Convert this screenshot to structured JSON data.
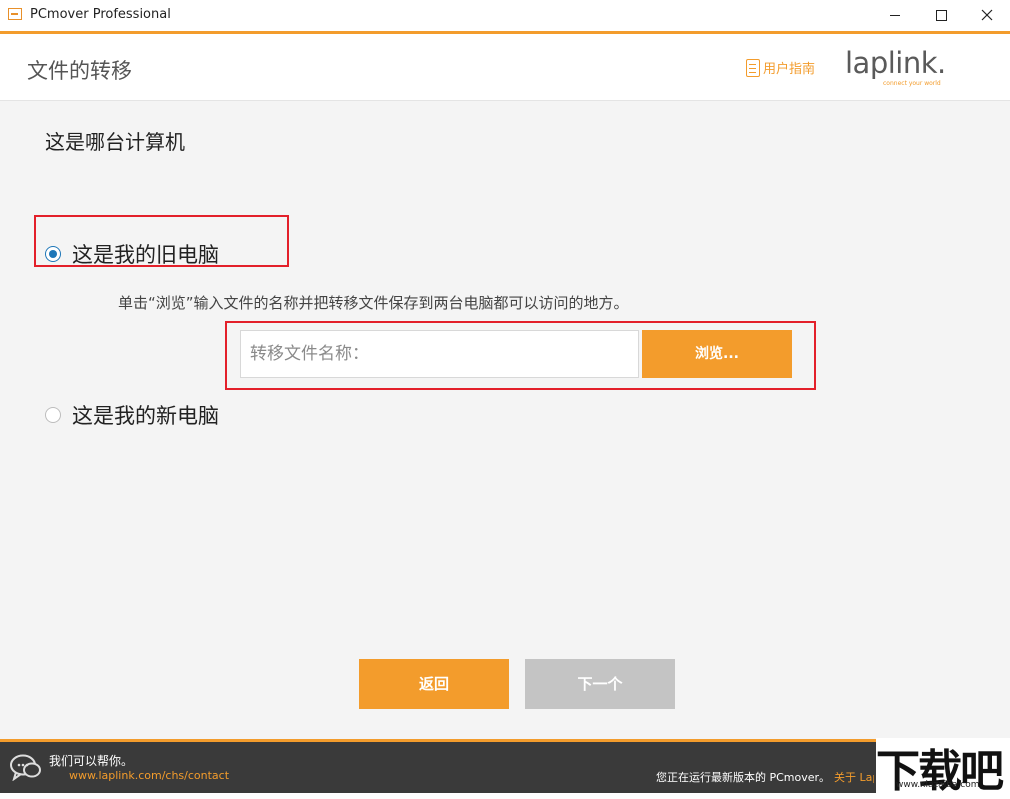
{
  "window": {
    "title": "PCmover Professional"
  },
  "header": {
    "title": "文件的转移",
    "guide_label": "用户指南",
    "logo_text": "laplink.",
    "logo_tagline": "connect your world"
  },
  "main": {
    "question": "这是哪台计算机",
    "option_old": {
      "label": "这是我的旧电脑",
      "checked": true
    },
    "instruction": "单击“浏览”输入文件的名称并把转移文件保存到两台电脑都可以访问的地方。",
    "file_input": {
      "placeholder": "转移文件名称：",
      "value": ""
    },
    "browse_label": "浏览...",
    "option_new": {
      "label": "这是我的新电脑",
      "checked": false
    },
    "back_label": "返回",
    "next_label": "下一个"
  },
  "footer": {
    "help_text": "我们可以帮你。",
    "help_link": "www.laplink.com/chs/contact",
    "status": "您正在运行最新版本的 PCmover。",
    "about_link": "关于 Laplink"
  },
  "watermark": {
    "main": "下载吧",
    "sub": "www.xiazaiba.com"
  },
  "colors": {
    "accent": "#f39c2c",
    "radio_selected": "#1e77b8",
    "highlight_box": "#e3202a",
    "disabled_button": "#c4c4c4",
    "footer_bg": "#3a3a3a"
  }
}
